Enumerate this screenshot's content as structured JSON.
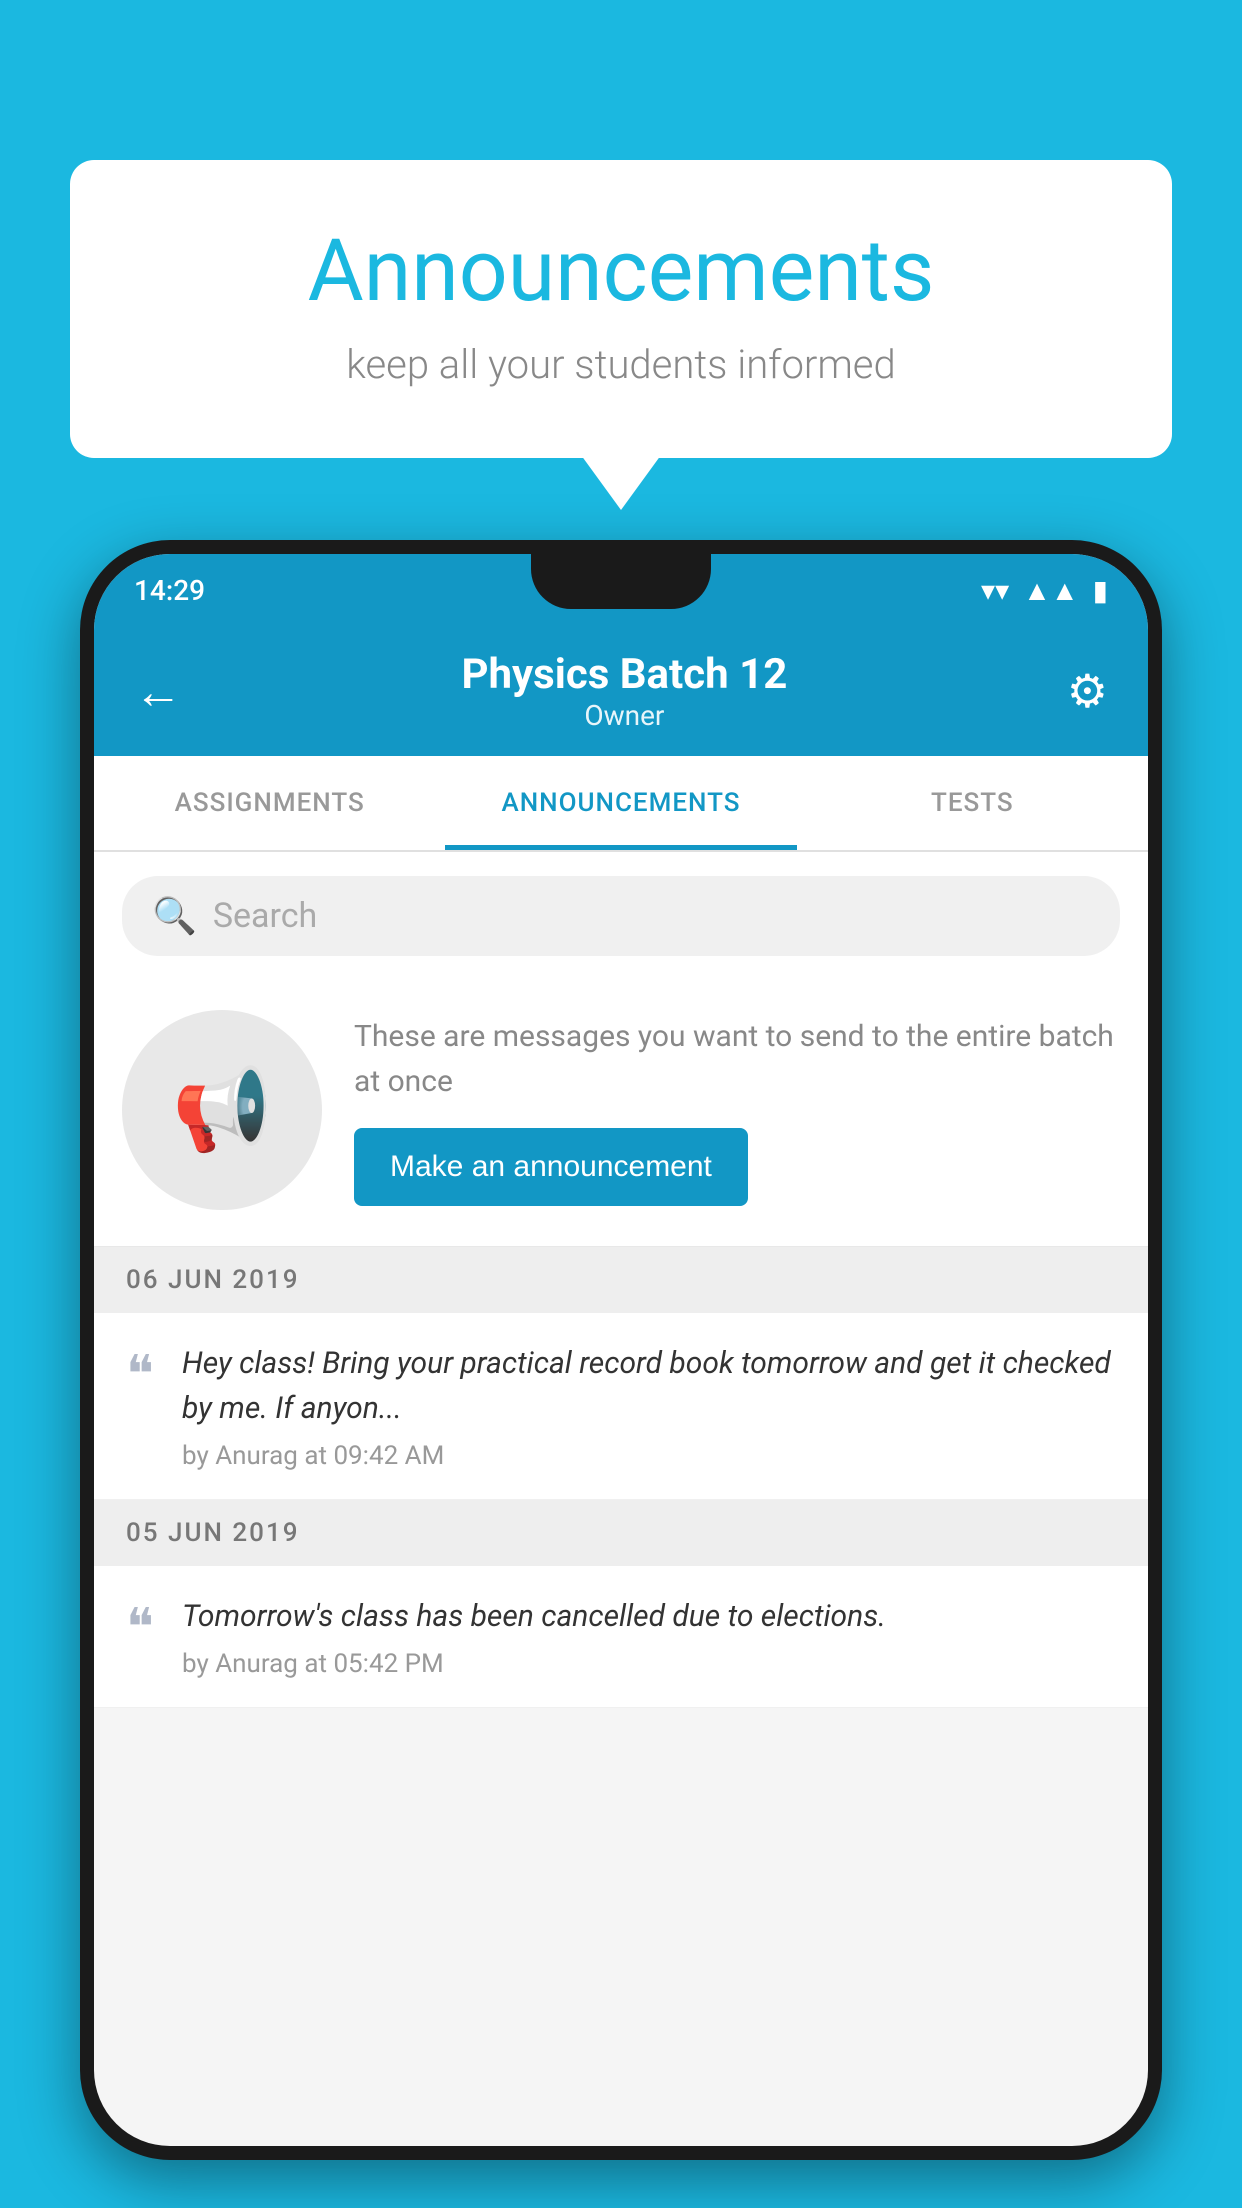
{
  "page": {
    "background_color": "#1bb8e0"
  },
  "bubble": {
    "title": "Announcements",
    "subtitle": "keep all your students informed"
  },
  "phone": {
    "status_bar": {
      "time": "14:29"
    },
    "top_bar": {
      "title": "Physics Batch 12",
      "subtitle": "Owner",
      "back_label": "←",
      "gear_label": "⚙"
    },
    "tabs": [
      {
        "label": "ASSIGNMENTS",
        "active": false
      },
      {
        "label": "ANNOUNCEMENTS",
        "active": true
      },
      {
        "label": "TESTS",
        "active": false
      }
    ],
    "search": {
      "placeholder": "Search"
    },
    "promo": {
      "description": "These are messages you want to send to the entire batch at once",
      "button_label": "Make an announcement"
    },
    "announcements": [
      {
        "date": "06  JUN  2019",
        "message": "Hey class! Bring your practical record book tomorrow and get it checked by me. If anyon...",
        "meta": "by Anurag at 09:42 AM"
      },
      {
        "date": "05  JUN  2019",
        "message": "Tomorrow's class has been cancelled due to elections.",
        "meta": "by Anurag at 05:42 PM"
      }
    ]
  }
}
